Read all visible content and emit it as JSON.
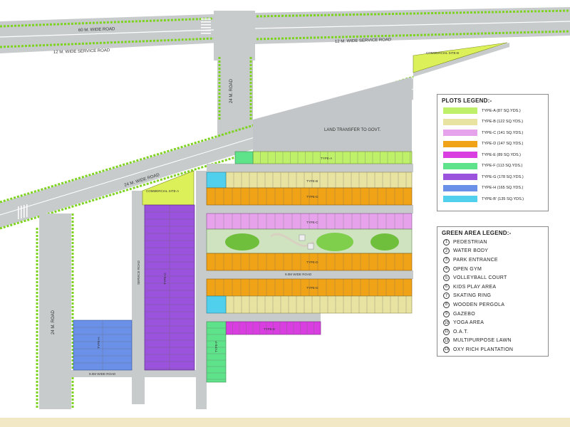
{
  "colors": {
    "type_a": "#bff06a",
    "type_b": "#e8e3a0",
    "type_c": "#e6a3ec",
    "type_d": "#f0a317",
    "type_e": "#d93fe0",
    "type_f": "#5fe38a",
    "type_g": "#9b52dc",
    "type_h": "#6b90e8",
    "type_b2": "#51d0ee",
    "road": "#c7cbcc",
    "land_transfer": "#c3c6c8",
    "tree": "#7ed321",
    "park": "#cfe3c0",
    "commercial": "#dcf05a",
    "footer": "#f3e8c6"
  },
  "roads": {
    "main_road": "60 M. WIDE ROAD",
    "service_road_left": "12 M. WIDE SERVICE ROAD",
    "service_road_right": "12 M. WIDE SERVICE ROAD",
    "road_24_vertical_top": "24 M. ROAD",
    "road_24_diagonal": "24 M. WIDE ROAD",
    "road_24_left": "24 M. ROAD",
    "road_9_bottom": "9.0M WIDE ROAD",
    "road_service_small": "SERVICE ROAD",
    "road_9_inner": "9.0M WIDE ROAD"
  },
  "sites": {
    "commercial_b": "COMMERCIAL SITE-B",
    "commercial_a": "COMMERCIAL SITE-A",
    "land_transfer": "LAND TRANSFER TO GOVT."
  },
  "plot_tags": {
    "type_a": "TYPE-A",
    "type_b": "TYPE-B",
    "type_c": "TYPE-C",
    "type_d": "TYPE-D",
    "type_e": "TYPE-E",
    "type_f": "TYPE-F",
    "type_g": "TYPE-G",
    "type_h": "TYPE-H"
  },
  "plots_legend": {
    "title": "PLOTS LEGEND:-",
    "items": [
      {
        "label": "TYPE-A (87 SQ.YDS.)",
        "color": "#bff06a"
      },
      {
        "label": "TYPE-B (122 SQ.YDS.)",
        "color": "#e8e3a0"
      },
      {
        "label": "TYPE-C (141 SQ.YDS.)",
        "color": "#e6a3ec"
      },
      {
        "label": "TYPE-D (147 SQ.YDS.)",
        "color": "#f0a317"
      },
      {
        "label": "TYPE-E (89 SQ.YDS.)",
        "color": "#d93fe0"
      },
      {
        "label": "TYPE-F (113 SQ.YDS.)",
        "color": "#5fe38a"
      },
      {
        "label": "TYPE-G (178 SQ.YDS.)",
        "color": "#9b52dc"
      },
      {
        "label": "TYPE-H (165 SQ.YDS.)",
        "color": "#6b90e8"
      },
      {
        "label": "TYPE-B' (135 SQ.YDS.)",
        "color": "#51d0ee"
      }
    ]
  },
  "green_legend": {
    "title": "GREEN AREA LEGEND:-",
    "items": [
      {
        "num": "1",
        "label": "PEDESTRIAN"
      },
      {
        "num": "2",
        "label": "WATER BODY"
      },
      {
        "num": "3",
        "label": "PARK ENTRANCE"
      },
      {
        "num": "4",
        "label": "OPEN GYM"
      },
      {
        "num": "5",
        "label": "VOLLEYBALL COURT"
      },
      {
        "num": "6",
        "label": "KIDS PLAY AREA"
      },
      {
        "num": "7",
        "label": "SKATING RING"
      },
      {
        "num": "8",
        "label": "WOODEN PERGOLA"
      },
      {
        "num": "9",
        "label": "GAZEBO"
      },
      {
        "num": "10",
        "label": "YOGA AREA"
      },
      {
        "num": "11",
        "label": "O.A.T."
      },
      {
        "num": "12",
        "label": "MULTIPURPOSE LAWN"
      },
      {
        "num": "13",
        "label": "OXY RICH PLANTATION"
      }
    ]
  }
}
